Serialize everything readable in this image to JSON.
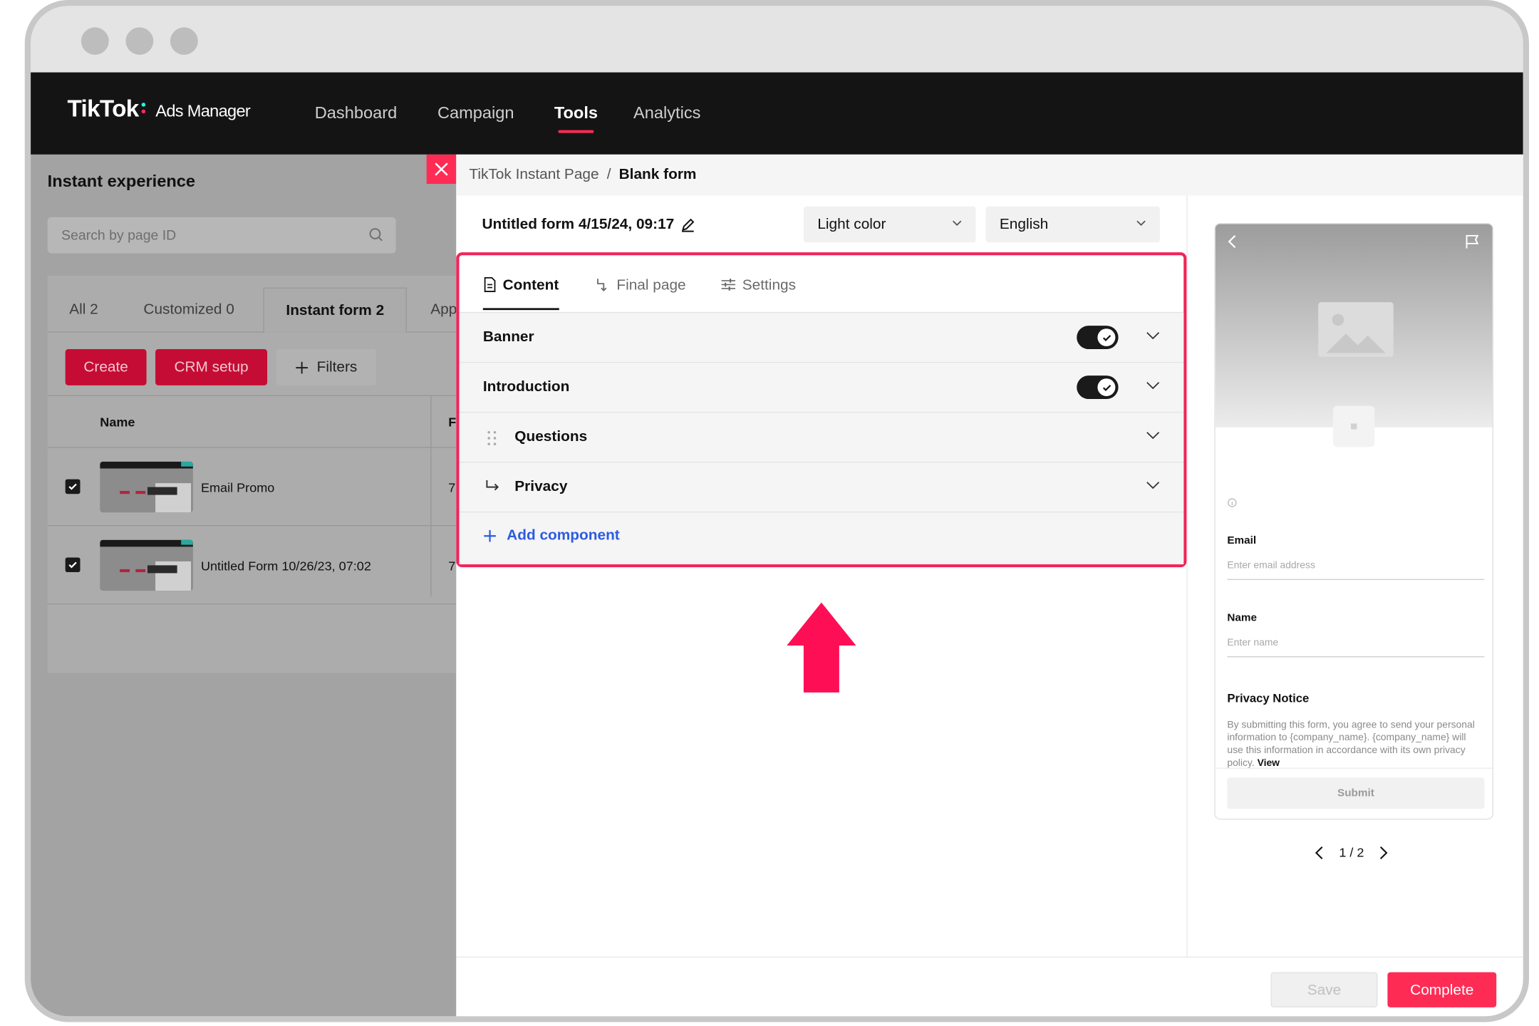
{
  "topbar": {
    "logo": "TikTok",
    "logo_sub": "Ads Manager",
    "nav": [
      "Dashboard",
      "Campaign",
      "Tools",
      "Analytics"
    ],
    "active_nav": "Tools"
  },
  "left": {
    "title": "Instant experience",
    "search_placeholder": "Search by page ID",
    "tabs": [
      "All 2",
      "Customized 0",
      "Instant form 2",
      "App"
    ],
    "buttons": {
      "create": "Create",
      "crm": "CRM setup",
      "filters": "Filters"
    },
    "table": {
      "col_name": "Name",
      "col_2": "F",
      "rows": [
        {
          "name": "Email Promo",
          "col2": "7"
        },
        {
          "name": "Untitled Form 10/26/23, 07:02",
          "col2": "7"
        }
      ]
    }
  },
  "drawer": {
    "breadcrumb": {
      "parent": "TikTok Instant Page",
      "sep": "/",
      "current": "Blank form"
    },
    "form_title": "Untitled form 4/15/24, 09:17",
    "theme_select": "Light color",
    "language_select": "English",
    "tabs": [
      "Content",
      "Final page",
      "Settings"
    ],
    "sections": [
      {
        "label": "Banner",
        "toggle": true
      },
      {
        "label": "Introduction",
        "toggle": true
      },
      {
        "label": "Questions",
        "toggle": false
      },
      {
        "label": "Privacy",
        "toggle": false
      }
    ],
    "add_component": "Add component",
    "save": "Save",
    "complete": "Complete",
    "accent_color": "#fe2c55",
    "link_color": "#2c5be0"
  },
  "preview": {
    "fields": [
      {
        "label": "Email",
        "placeholder": "Enter email address"
      },
      {
        "label": "Name",
        "placeholder": "Enter name"
      }
    ],
    "privacy_title": "Privacy Notice",
    "privacy_text": "By submitting this form, you agree to send your personal information to {company_name}. {company_name} will use this information in accordance with its own privacy policy.",
    "privacy_link": "View",
    "submit": "Submit",
    "pager": "1 / 2"
  }
}
